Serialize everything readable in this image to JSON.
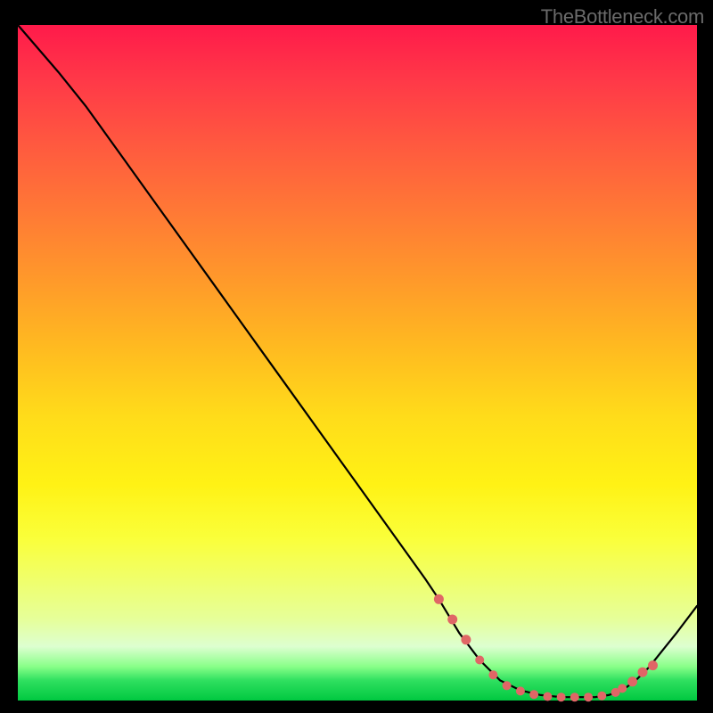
{
  "watermark": "TheBottleneck.com",
  "chart_data": {
    "type": "line",
    "title": "",
    "xlabel": "",
    "ylabel": "",
    "xlim": [
      0,
      100
    ],
    "ylim": [
      0,
      100
    ],
    "series": [
      {
        "name": "bottleneck-curve",
        "x": [
          0,
          6,
          10,
          15,
          20,
          25,
          30,
          35,
          40,
          45,
          50,
          55,
          60,
          62,
          65,
          68,
          71,
          74,
          77,
          80,
          83,
          85,
          87,
          89,
          91,
          93,
          95,
          97,
          100
        ],
        "values": [
          100,
          93,
          88,
          81,
          74,
          67,
          60,
          53,
          46,
          39,
          32,
          25,
          18,
          15,
          10,
          6,
          3,
          1.5,
          0.8,
          0.5,
          0.5,
          0.5,
          0.8,
          1.5,
          3,
          5,
          7.5,
          10,
          14
        ]
      }
    ],
    "markers": {
      "name": "highlight-dots",
      "x": [
        62,
        64,
        66,
        68,
        70,
        72,
        74,
        76,
        78,
        80,
        82,
        84,
        86,
        88,
        89,
        90.5,
        92,
        93.5
      ],
      "values": [
        15,
        12,
        9,
        6,
        3.8,
        2.2,
        1.4,
        0.9,
        0.6,
        0.5,
        0.5,
        0.5,
        0.7,
        1.2,
        1.8,
        2.8,
        4.2,
        5.2
      ]
    },
    "colors": {
      "curve": "#000000",
      "marker": "#e06666"
    }
  }
}
